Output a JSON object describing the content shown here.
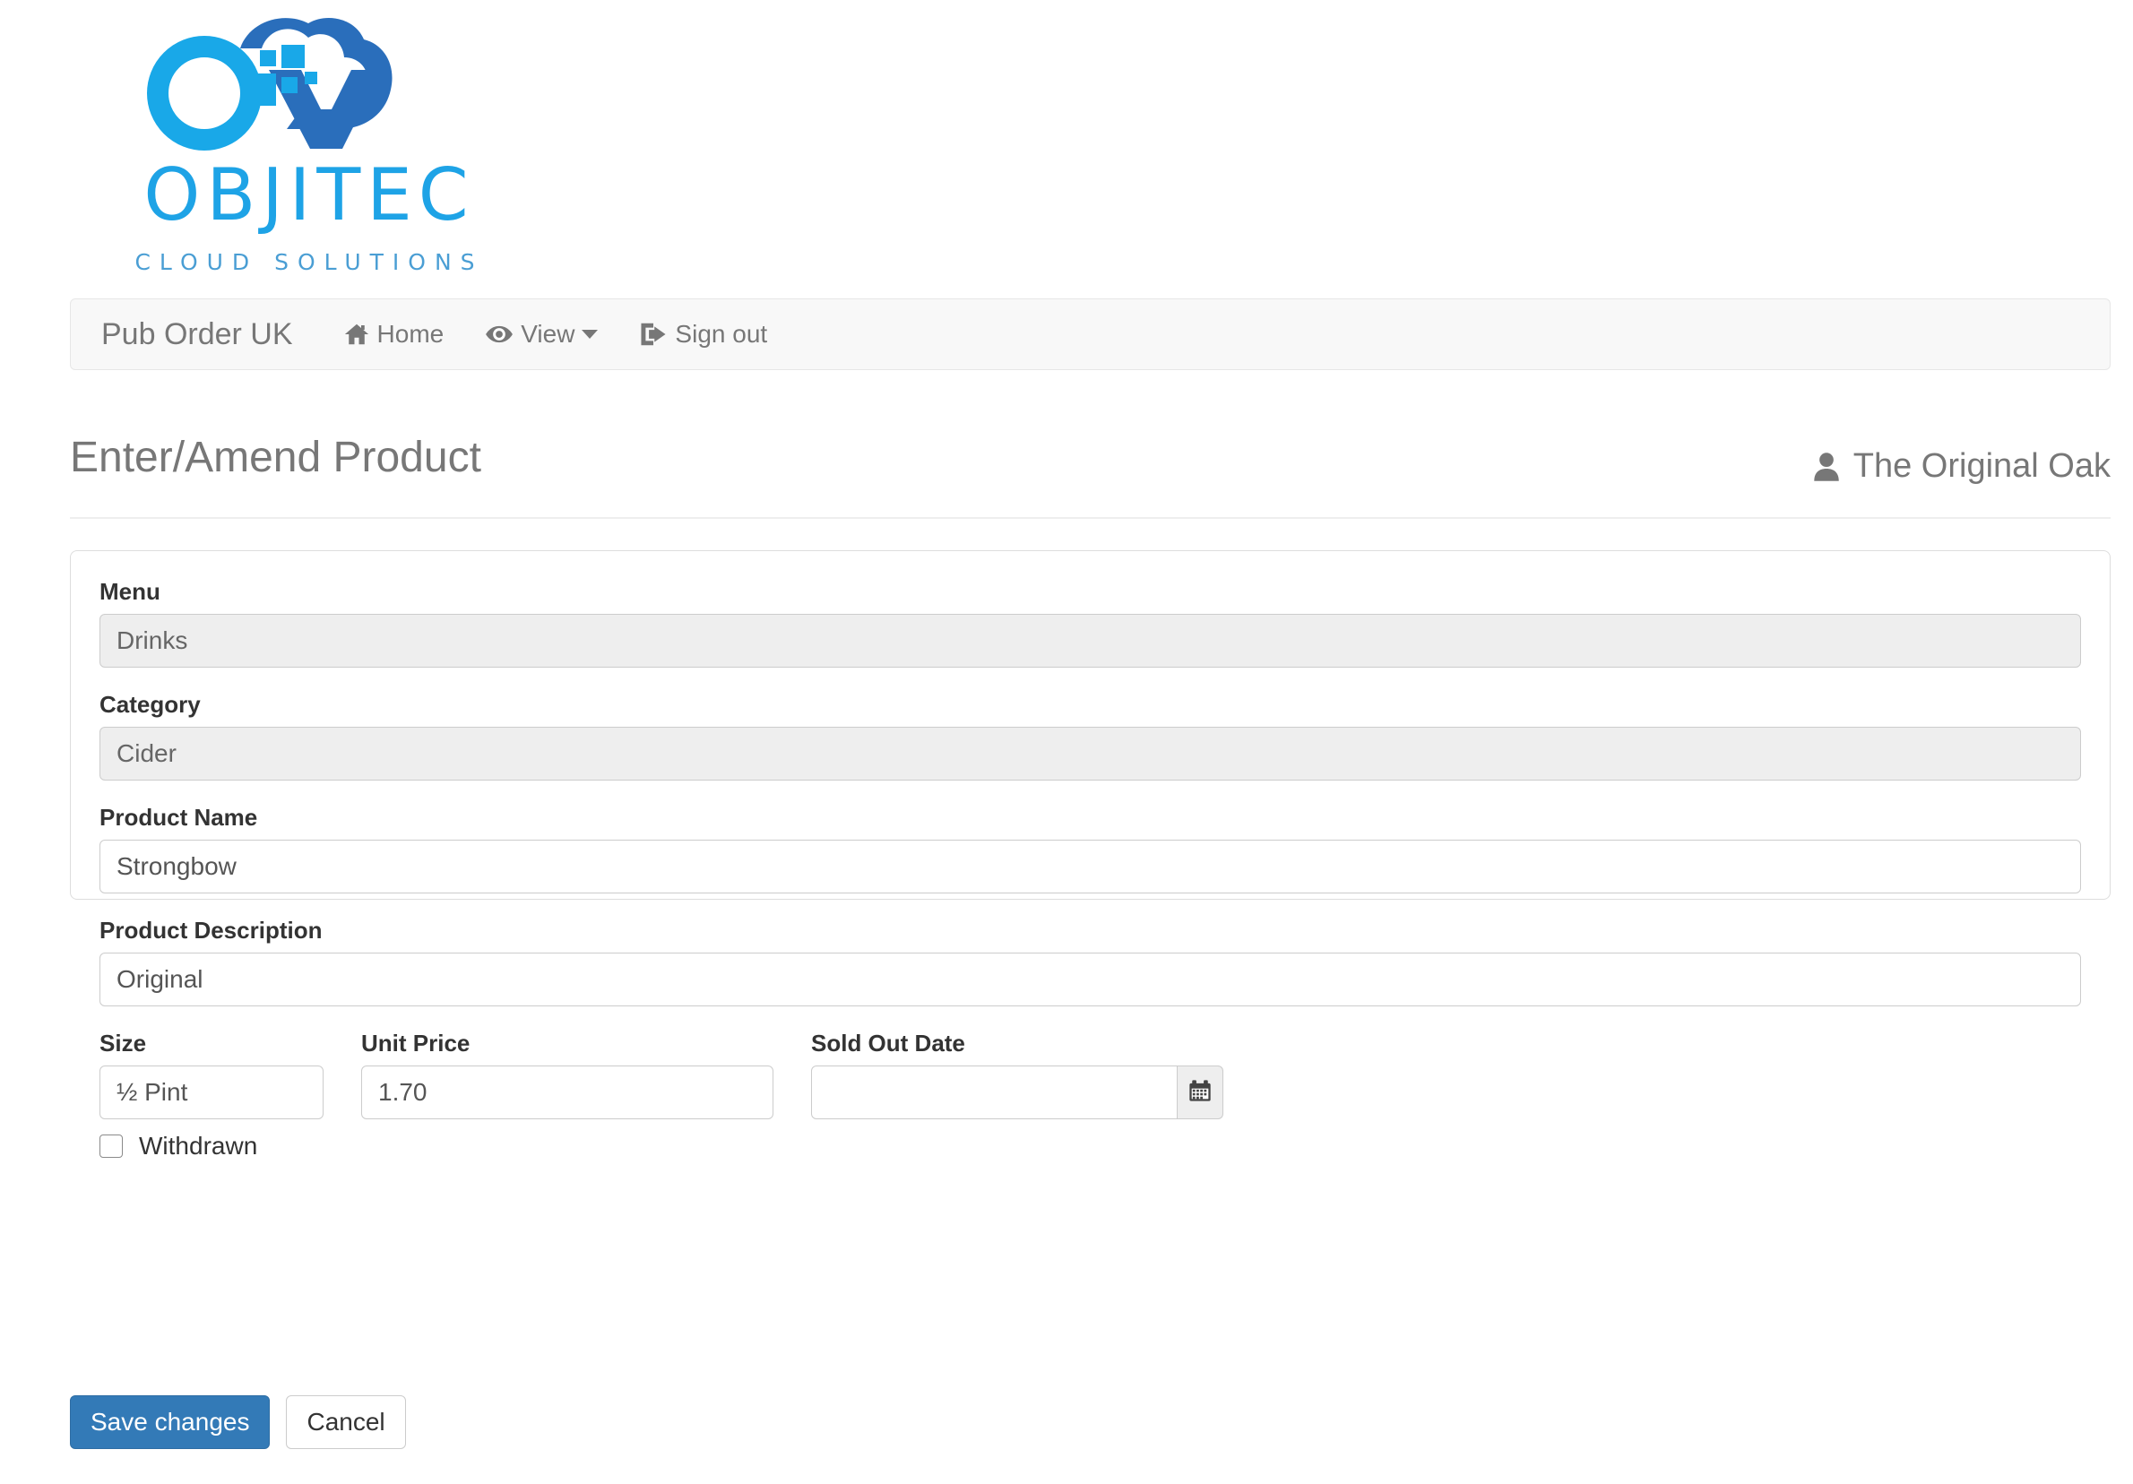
{
  "brand": {
    "logo_word": "OBJITEC",
    "logo_sub": "CLOUD SOLUTIONS",
    "logo_icon": "cloud-infinity-logo",
    "color_light": "#1ea3e6",
    "color_dark": "#2a6ebb"
  },
  "navbar": {
    "brand": "Pub Order UK",
    "items": [
      {
        "label": "Home",
        "icon": "home-icon"
      },
      {
        "label": "View",
        "icon": "eye-icon",
        "caret": true
      },
      {
        "label": "Sign out",
        "icon": "sign-out-icon"
      }
    ]
  },
  "header": {
    "title": "Enter/Amend Product",
    "user": "The Original Oak",
    "user_icon": "user-icon"
  },
  "form": {
    "menu": {
      "label": "Menu",
      "value": "Drinks",
      "disabled": true
    },
    "category": {
      "label": "Category",
      "value": "Cider",
      "disabled": true
    },
    "product_name": {
      "label": "Product Name",
      "value": "Strongbow",
      "placeholder": ""
    },
    "product_description": {
      "label": "Product Description",
      "value": "Original",
      "placeholder": ""
    },
    "size": {
      "label": "Size",
      "value": "½ Pint",
      "placeholder": ""
    },
    "unit_price": {
      "label": "Unit Price",
      "value": "1.70",
      "placeholder": ""
    },
    "sold_out_date": {
      "label": "Sold Out Date",
      "value": "",
      "placeholder": "",
      "addon_icon": "calendar-icon"
    },
    "withdrawn": {
      "label": "Withdrawn",
      "checked": false
    }
  },
  "actions": {
    "save_label": "Save changes",
    "cancel_label": "Cancel",
    "primary_color": "#337ab7"
  }
}
